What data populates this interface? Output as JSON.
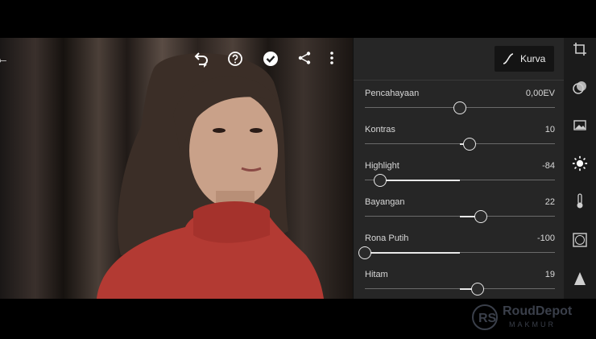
{
  "toolbar": {
    "back_label": "←"
  },
  "profile_button": {
    "label": "Kurva"
  },
  "adjustments": [
    {
      "label": "Pencahayaan",
      "value_text": "0,00EV",
      "position": 0.5,
      "fill_from": 0.5
    },
    {
      "label": "Kontras",
      "value_text": "10",
      "position": 0.55,
      "fill_from": 0.5
    },
    {
      "label": "Highlight",
      "value_text": "-84",
      "position": 0.08,
      "fill_from": 0.5
    },
    {
      "label": "Bayangan",
      "value_text": "22",
      "position": 0.61,
      "fill_from": 0.5
    },
    {
      "label": "Rona Putih",
      "value_text": "-100",
      "position": 0.0,
      "fill_from": 0.5
    },
    {
      "label": "Hitam",
      "value_text": "19",
      "position": 0.595,
      "fill_from": 0.5
    }
  ],
  "rail": {
    "icons": [
      "crop-icon",
      "selective-icon",
      "image-adjust-icon",
      "light-icon",
      "color-temperature-icon",
      "vignette-icon",
      "triangle-icon"
    ],
    "active": "light-icon"
  },
  "watermark": {
    "brand": "RoudDepot",
    "sub": "MAKMUR"
  }
}
